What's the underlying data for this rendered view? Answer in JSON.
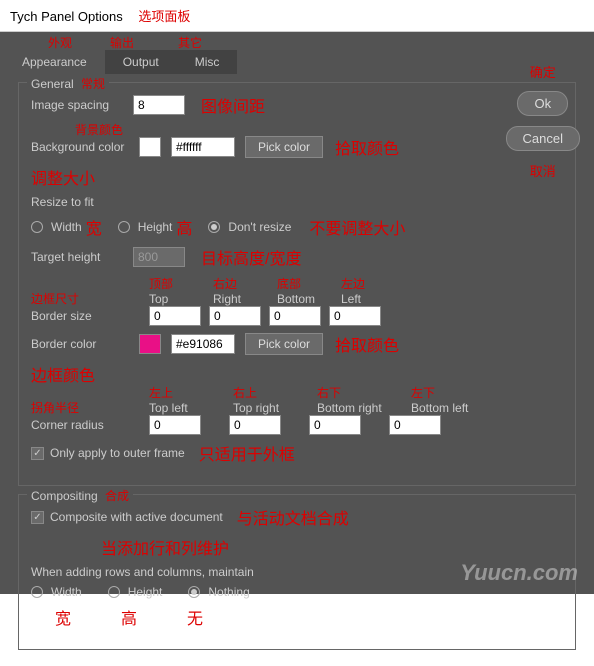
{
  "title": "Tych Panel Options",
  "title_cn": "选项面板",
  "tabs": [
    {
      "label": "Appearance",
      "cn": "外观"
    },
    {
      "label": "Output",
      "cn": "输出"
    },
    {
      "label": "Misc",
      "cn": "其它"
    }
  ],
  "general": {
    "legend": "General",
    "legend_cn": "常规",
    "image_spacing_lbl": "Image spacing",
    "image_spacing_val": "8",
    "image_spacing_cn": "图像间距",
    "bg_cn": "背景颜色",
    "bg_lbl": "Background color",
    "bg_hex": "#ffffff",
    "pick_color": "Pick color",
    "pick_cn": "拾取颜色",
    "resize_cn": "调整大小",
    "resize_lbl": "Resize to fit",
    "width_lbl": "Width",
    "width_cn": "宽",
    "height_lbl": "Height",
    "height_cn": "高",
    "dont_resize": "Don't resize",
    "dont_resize_cn": "不要调整大小",
    "target_lbl": "Target height",
    "target_val": "800",
    "target_cn": "目标高度/宽度",
    "border_cn": "边框尺寸",
    "border_size_lbl": "Border size",
    "border_vals": [
      "0",
      "0",
      "0",
      "0"
    ],
    "border_hdrs": [
      {
        "cn": "顶部",
        "en": "Top"
      },
      {
        "cn": "右边",
        "en": "Right"
      },
      {
        "cn": "底部",
        "en": "Bottom"
      },
      {
        "cn": "左边",
        "en": "Left"
      }
    ],
    "border_color_lbl": "Border color",
    "border_color_cn": "边框颜色",
    "border_hex": "#e91086",
    "corner_cn": "拐角半径",
    "corner_lbl": "Corner radius",
    "corner_vals": [
      "0",
      "0",
      "0",
      "0"
    ],
    "corner_hdrs": [
      {
        "cn": "左上",
        "en": "Top left"
      },
      {
        "cn": "右上",
        "en": "Top right"
      },
      {
        "cn": "右下",
        "en": "Bottom right"
      },
      {
        "cn": "左下",
        "en": "Bottom left"
      }
    ],
    "outer_lbl": "Only apply to outer frame",
    "outer_cn": "只适用于外框"
  },
  "compositing": {
    "legend": "Compositing",
    "legend_cn": "合成",
    "composite_lbl": "Composite with active document",
    "composite_cn": "与活动文档合成",
    "maintain_cn": "当添加行和列维护",
    "maintain_lbl": "When adding rows and columns, maintain",
    "width": "Width",
    "width_cn": "宽",
    "height": "Height",
    "height_cn": "高",
    "nothing": "Nothing",
    "nothing_cn": "无"
  },
  "right": {
    "ok_cn": "确定",
    "ok": "Ok",
    "cancel": "Cancel",
    "cancel_cn": "取消"
  },
  "watermark": "Yuucn.com"
}
